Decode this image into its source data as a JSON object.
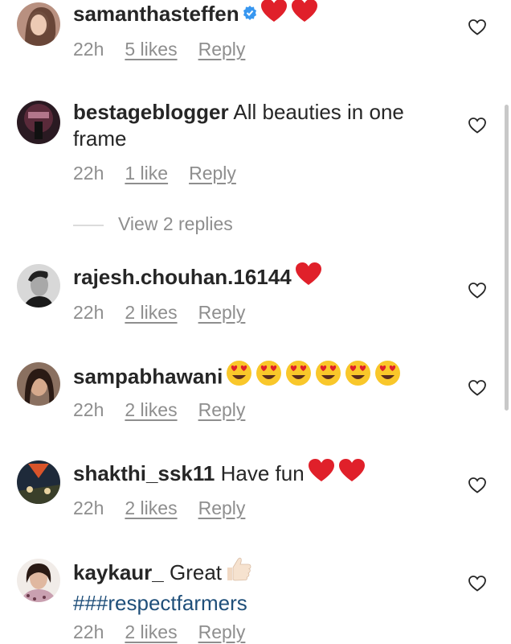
{
  "comments": [
    {
      "username": "samanthasteffen",
      "verified": true,
      "text": "",
      "emojis": [
        "red-heart",
        "red-heart"
      ],
      "time": "22h",
      "likes": "5 likes",
      "reply": "Reply"
    },
    {
      "username": "bestageblogger",
      "text": "All beauties in one",
      "text2": "frame",
      "time": "22h",
      "likes": "1 like",
      "reply": "Reply"
    },
    {
      "username": "rajesh.chouhan.16144",
      "text": "",
      "emojis": [
        "red-heart"
      ],
      "time": "22h",
      "likes": "2 likes",
      "reply": "Reply"
    },
    {
      "username": "sampabhawani",
      "text": "",
      "emojis": [
        "heart-eyes",
        "heart-eyes",
        "heart-eyes",
        "heart-eyes",
        "heart-eyes",
        "heart-eyes"
      ],
      "time": "22h",
      "likes": "2 likes",
      "reply": "Reply"
    },
    {
      "username": "shakthi_ssk11",
      "text": "Have fun",
      "emojis": [
        "red-heart",
        "red-heart"
      ],
      "time": "22h",
      "likes": "2 likes",
      "reply": "Reply"
    },
    {
      "username": "kaykaur_",
      "text": "Great",
      "emojis": [
        "thumbs-up"
      ],
      "hashtag": "###respectfarmers",
      "time": "22h",
      "likes": "2 likes",
      "reply": "Reply"
    }
  ],
  "view_replies": "View 2 replies",
  "colors": {
    "text": "#262626",
    "meta": "#8e8e8e",
    "hashtag": "#1f4f7a",
    "heart": "#e0202a",
    "verified": "#3897f0"
  }
}
